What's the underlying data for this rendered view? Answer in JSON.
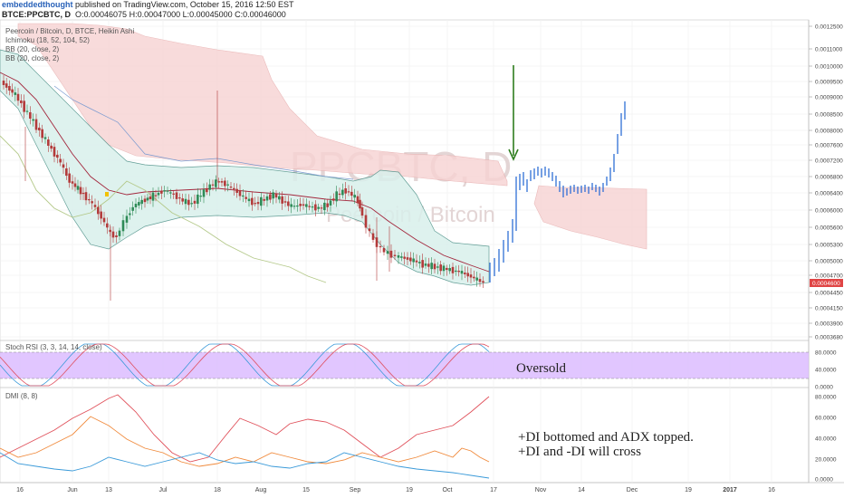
{
  "header": {
    "user": "embeddedthought",
    "published": "published on TradingView.com, October 15, 2016 12:50 EST",
    "symbol_line": "BTCE:PPCBTC, D",
    "ohlc": "O:0.00046075  H:0.00047000  L:0.00045000  C:0.00046000",
    "last": "0.0004600"
  },
  "main_legend": [
    "Peercoin / Bitcoin, D, BTCE, Heikin Ashi",
    "Ichimoku (18, 52, 104, 52)",
    "BB (20, close, 2)",
    "BB (20, close, 2)"
  ],
  "watermark": {
    "symbol": "PPCBTC, D",
    "name": "Peercoin / Bitcoin"
  },
  "price_ticks": [
    "0.0012500",
    "0.0011000",
    "0.0010000",
    "0.0009500",
    "0.0009000",
    "0.0008500",
    "0.0008000",
    "0.0007600",
    "0.0007200",
    "0.0006800",
    "0.0006400",
    "0.0006000",
    "0.0005600",
    "0.0005300",
    "0.0005000",
    "0.0004700",
    "0.0004600",
    "0.0004450",
    "0.0004150",
    "0.0003900",
    "0.0003680"
  ],
  "x_ticks": [
    "16",
    "Jun",
    "13",
    "Jul",
    "18",
    "Aug",
    "15",
    "Sep",
    "19",
    "Oct",
    "17",
    "Nov",
    "14",
    "Dec",
    "19",
    "2017",
    "16"
  ],
  "stoch": {
    "title": "Stoch RSI (3, 3, 14, 14, close)",
    "ticks": [
      "80.0000",
      "40.0000",
      "0.0000"
    ],
    "zone_label": "Oversold"
  },
  "dmi": {
    "title": "DMI (8, 8)",
    "ticks": [
      "80.0000",
      "60.0000",
      "40.0000",
      "20.0000",
      "0.0000"
    ],
    "note_1": "+DI bottomed and ADX topped.",
    "note_2": "+DI and -DI will cross"
  },
  "colors": {
    "bull": "#2e8b57",
    "bear": "#b33a3a",
    "projection": "#2f6fd6",
    "cloud_red": "#f7d3d3",
    "band_fill": "#d9f0ec",
    "oversold": "#d9b8ff",
    "arrow": "#2e7d1e",
    "adx": "#e0505a",
    "plus_di": "#3a9ad9",
    "minus_di": "#f08a3c"
  }
}
